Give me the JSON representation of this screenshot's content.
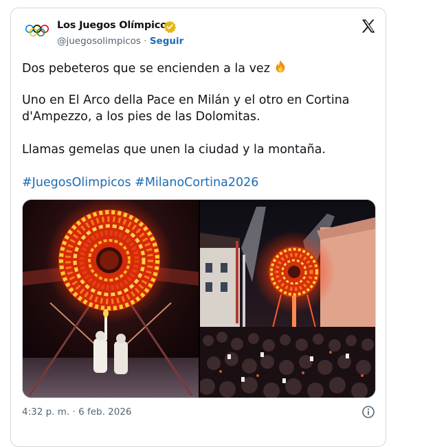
{
  "tweet": {
    "display_name": "Los Juegos Olímpicos",
    "handle": "@juegosolimpicos",
    "separator": "·",
    "follow_label": "Seguir",
    "line1": "Dos pebeteros que se encienden a la vez",
    "line2": "Uno en El Arco della Pace en Milán y el otro en Cortina d'Ampezzo, a los pies de las Dolomitas.",
    "line3": "Llamas gemelas que unen la ciudad y la montaña.",
    "hashtags": [
      "#JuegosOlimpicos",
      "#MilanoCortina2026"
    ],
    "timestamp": "4:32 p. m. · 6 feb. 2026"
  },
  "icons": {
    "avatar": "olympic-rings-icon",
    "verified": "verified-badge-icon",
    "platform": "x-logo-icon",
    "emoji": "fire-emoji-icon",
    "info": "info-icon"
  },
  "colors": {
    "link": "#1d6bb5",
    "secondary_text": "#536471",
    "border": "#cfd9de",
    "verified_gold": "#e2b719"
  }
}
